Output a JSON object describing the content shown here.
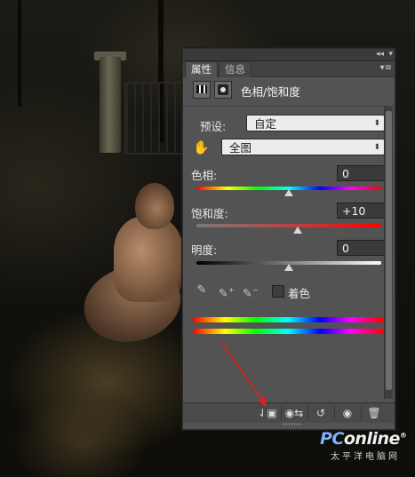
{
  "panel": {
    "tabs": [
      {
        "label": "属性"
      },
      {
        "label": "信息"
      }
    ],
    "collapse_glyph": "◂◂",
    "close_glyph": "▾",
    "menu_glyph": "▾≡",
    "header": {
      "title": "色相/饱和度",
      "icons": [
        "hue-saturation-icon",
        "layer-mask-icon"
      ]
    },
    "preset": {
      "label": "预设:",
      "value": "自定"
    },
    "channel": {
      "icon": "target-adjust-hand-icon",
      "value": "全图"
    },
    "hue": {
      "label": "色相:",
      "value": "0",
      "level": 0.5
    },
    "saturation": {
      "label": "饱和度:",
      "value": "+10",
      "level": 0.55
    },
    "lightness": {
      "label": "明度:",
      "value": "0",
      "level": 0.5
    },
    "eyedroppers": [
      "eyedropper-icon",
      "eyedropper-plus-icon",
      "eyedropper-minus-icon"
    ],
    "colorize": {
      "label": "着色",
      "checked": false
    },
    "footer_buttons": [
      "clip-to-layer-icon",
      "view-previous-state-icon",
      "reset-icon",
      "toggle-visibility-icon",
      "delete-icon"
    ]
  },
  "watermark": {
    "brand_prefix": "PC",
    "brand_rest": "online",
    "brand_suffix": "®",
    "subtitle": "太平洋电脑网"
  },
  "colors": {
    "panel_bg": "#535353",
    "annotation_arrow": "#e0201e"
  }
}
